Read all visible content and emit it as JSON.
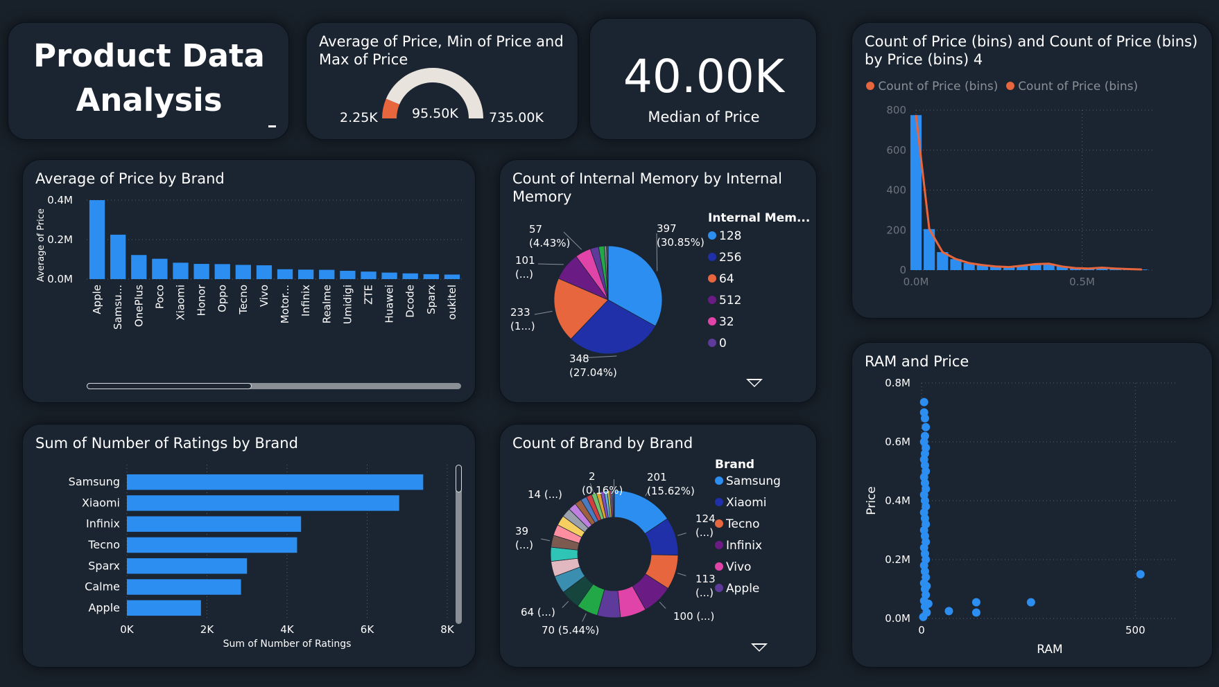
{
  "header": {
    "title_line1": "Product Data",
    "title_line2": "Analysis"
  },
  "gauge": {
    "title_line1": "Average of Price, Min of Price and",
    "title_line2": "Max of Price",
    "min_label": "2.25K",
    "value_label": "95.50K",
    "max_label": "735.00K",
    "min": 2250,
    "value": 95500,
    "max": 735000,
    "colors": {
      "fill": "#e8663d",
      "track": "#e8e3dc"
    }
  },
  "kpi": {
    "value": "40.00K",
    "label": "Median of Price"
  },
  "chart_data": [
    {
      "id": "avg_price_by_brand",
      "type": "bar",
      "title": "Average of Price by Brand",
      "ylabel": "Average of Price",
      "xlabel": "",
      "categories": [
        "Apple",
        "Samsu...",
        "OnePlus",
        "Poco",
        "Xiaomi",
        "Honor",
        "Oppo",
        "Tecno",
        "Vivo",
        "Motor...",
        "Infinix",
        "Realme",
        "Umidigi",
        "ZTE",
        "Huawei",
        "Dcode",
        "Sparx",
        "oukitel"
      ],
      "values": [
        400000,
        225000,
        122000,
        103000,
        83000,
        77000,
        76000,
        72000,
        70000,
        50000,
        48000,
        47000,
        42000,
        38000,
        33000,
        29000,
        25000,
        23000
      ],
      "ylim": [
        0,
        400000
      ],
      "yticks": [
        "0.0M",
        "0.2M",
        "0.4M"
      ],
      "ytick_values": [
        0,
        200000,
        400000
      ],
      "color": "#2b8ef0"
    },
    {
      "id": "internal_memory_pie",
      "type": "pie",
      "title_line1": "Count of Internal Memory by Internal",
      "title_line2": "Memory",
      "legend_title": "Internal Mem...",
      "slices": [
        {
          "label": "128",
          "value": 397,
          "color": "#2b8ef0"
        },
        {
          "label": "256",
          "value": 348,
          "color": "#1f30a8"
        },
        {
          "label": "64",
          "value": 233,
          "color": "#e8663d"
        },
        {
          "label": "512",
          "value": 101,
          "color": "#6a1c84"
        },
        {
          "label": "32",
          "value": 57,
          "color": "#e044a8"
        },
        {
          "label": "0",
          "value": 30,
          "color": "#5e3a9a"
        },
        {
          "label": "",
          "value": 20,
          "color": "#22a846"
        },
        {
          "label": "",
          "value": 8,
          "color": "#8a8a8a"
        },
        {
          "label": "",
          "value": 4,
          "color": "#2ec4b6"
        },
        {
          "label": "",
          "value": 2,
          "color": "#d8d8d8"
        }
      ],
      "data_labels": [
        {
          "value": "397",
          "pct": "(30.85%)"
        },
        {
          "value": "348",
          "pct": "(27.04%)"
        },
        {
          "value": "233",
          "pct": "(1...)"
        },
        {
          "value": "101",
          "pct": "(...)"
        },
        {
          "value": "57",
          "pct": "(4.43%)"
        }
      ]
    },
    {
      "id": "price_bins_hist",
      "type": "bar",
      "title_line1": "Count of Price (bins) and Count of Price (bins)",
      "title_line2": "by Price (bins) 4",
      "legend": [
        "Count of Price (bins)",
        "Count of Price (bins)"
      ],
      "legend_color": "#e8663d",
      "x": [
        0.0,
        0.04,
        0.08,
        0.12,
        0.16,
        0.2,
        0.24,
        0.28,
        0.32,
        0.36,
        0.4,
        0.44,
        0.48,
        0.52,
        0.56,
        0.6,
        0.64,
        0.68
      ],
      "values": [
        775,
        205,
        90,
        55,
        35,
        25,
        18,
        15,
        22,
        30,
        32,
        18,
        10,
        8,
        12,
        8,
        5,
        3
      ],
      "xlim": [
        0,
        0.72
      ],
      "xticks": [
        "0.0M",
        "0.5M"
      ],
      "xtick_values": [
        0,
        0.5
      ],
      "ylim": [
        0,
        800
      ],
      "yticks": [
        "0",
        "200",
        "400",
        "600",
        "800"
      ],
      "ytick_values": [
        0,
        200,
        400,
        600,
        800
      ],
      "bar_color": "#2b8ef0",
      "line_color": "#e8663d"
    },
    {
      "id": "ratings_by_brand",
      "type": "bar",
      "orientation": "horizontal",
      "title": "Sum of Number of Ratings by Brand",
      "xlabel": "Sum of Number of Ratings",
      "categories": [
        "Samsung",
        "Xiaomi",
        "Infinix",
        "Tecno",
        "Sparx",
        "Calme",
        "Apple"
      ],
      "values": [
        7400,
        6800,
        4350,
        4250,
        3000,
        2850,
        1850
      ],
      "xlim": [
        0,
        8000
      ],
      "xticks": [
        "0K",
        "2K",
        "4K",
        "6K",
        "8K"
      ],
      "xtick_values": [
        0,
        2000,
        4000,
        6000,
        8000
      ],
      "color": "#2b8ef0"
    },
    {
      "id": "brand_donut",
      "type": "pie",
      "title": "Count of Brand by Brand",
      "legend_title": "Brand",
      "slices": [
        {
          "label": "Samsung",
          "value": 201,
          "color": "#2b8ef0"
        },
        {
          "label": "Xiaomi",
          "value": 124,
          "color": "#1f30a8"
        },
        {
          "label": "Tecno",
          "value": 113,
          "color": "#e8663d"
        },
        {
          "label": "Infinix",
          "value": 100,
          "color": "#6a1c84"
        },
        {
          "label": "Vivo",
          "value": 85,
          "color": "#e044a8"
        },
        {
          "label": "Apple",
          "value": 75,
          "color": "#5e3a9a"
        },
        {
          "label": "",
          "value": 70,
          "color": "#22a846"
        },
        {
          "label": "",
          "value": 64,
          "color": "#16453e"
        },
        {
          "label": "",
          "value": 58,
          "color": "#3a8fb0"
        },
        {
          "label": "",
          "value": 50,
          "color": "#e2b8c0"
        },
        {
          "label": "",
          "value": 46,
          "color": "#2ec4b6"
        },
        {
          "label": "",
          "value": 39,
          "color": "#7d5a50"
        },
        {
          "label": "",
          "value": 36,
          "color": "#ff8fa0"
        },
        {
          "label": "",
          "value": 33,
          "color": "#f5d060"
        },
        {
          "label": "",
          "value": 30,
          "color": "#9aa0ac"
        },
        {
          "label": "",
          "value": 26,
          "color": "#c080e0"
        },
        {
          "label": "",
          "value": 22,
          "color": "#a06040"
        },
        {
          "label": "",
          "value": 20,
          "color": "#4a7ac0"
        },
        {
          "label": "",
          "value": 18,
          "color": "#d04040"
        },
        {
          "label": "",
          "value": 16,
          "color": "#70c070"
        },
        {
          "label": "",
          "value": 14,
          "color": "#e0a030"
        },
        {
          "label": "",
          "value": 12,
          "color": "#8050c0"
        },
        {
          "label": "",
          "value": 10,
          "color": "#60b0e0"
        },
        {
          "label": "",
          "value": 8,
          "color": "#c0c040"
        },
        {
          "label": "",
          "value": 6,
          "color": "#b05090"
        },
        {
          "label": "",
          "value": 4,
          "color": "#50a0a0"
        },
        {
          "label": "",
          "value": 3,
          "color": "#a0a0ff"
        },
        {
          "label": "",
          "value": 2,
          "color": "#ffd0a0"
        }
      ],
      "data_labels": [
        {
          "value": "201",
          "pct": "(15.62%)"
        },
        {
          "value": "124",
          "pct": "(...)"
        },
        {
          "value": "113",
          "pct": "(...)"
        },
        {
          "value": "100 (...)",
          "pct": ""
        },
        {
          "value": "70 (5.44%)",
          "pct": ""
        },
        {
          "value": "64 (...)",
          "pct": ""
        },
        {
          "value": "39",
          "pct": "(...)"
        },
        {
          "value": "14 (...)",
          "pct": ""
        },
        {
          "value": "2",
          "pct": "(0.16%)"
        }
      ]
    },
    {
      "id": "ram_price_scatter",
      "type": "scatter",
      "title": "RAM and Price",
      "xlabel": "RAM",
      "ylabel": "Price",
      "xlim": [
        0,
        600
      ],
      "xticks": [
        "0",
        "500"
      ],
      "xtick_values": [
        0,
        500
      ],
      "ylim": [
        0,
        800000
      ],
      "yticks": [
        "0.0M",
        "0.2M",
        "0.4M",
        "0.6M",
        "0.8M"
      ],
      "ytick_values": [
        0,
        200000,
        400000,
        600000,
        800000
      ],
      "color": "#2b8ef0",
      "points": [
        [
          6,
          735000
        ],
        [
          6,
          700000
        ],
        [
          8,
          680000
        ],
        [
          10,
          650000
        ],
        [
          8,
          620000
        ],
        [
          6,
          600000
        ],
        [
          10,
          580000
        ],
        [
          8,
          560000
        ],
        [
          6,
          540000
        ],
        [
          8,
          520000
        ],
        [
          10,
          500000
        ],
        [
          6,
          480000
        ],
        [
          8,
          460000
        ],
        [
          10,
          440000
        ],
        [
          6,
          420000
        ],
        [
          8,
          400000
        ],
        [
          10,
          380000
        ],
        [
          6,
          360000
        ],
        [
          8,
          340000
        ],
        [
          10,
          320000
        ],
        [
          6,
          300000
        ],
        [
          8,
          280000
        ],
        [
          10,
          260000
        ],
        [
          6,
          240000
        ],
        [
          8,
          220000
        ],
        [
          10,
          200000
        ],
        [
          6,
          180000
        ],
        [
          8,
          160000
        ],
        [
          10,
          140000
        ],
        [
          6,
          120000
        ],
        [
          12,
          110000
        ],
        [
          8,
          100000
        ],
        [
          10,
          80000
        ],
        [
          6,
          60000
        ],
        [
          8,
          40000
        ],
        [
          12,
          20000
        ],
        [
          4,
          5000
        ],
        [
          16,
          50000
        ],
        [
          64,
          25000
        ],
        [
          128,
          55000
        ],
        [
          128,
          20000
        ],
        [
          256,
          55000
        ],
        [
          512,
          150000
        ]
      ]
    }
  ]
}
